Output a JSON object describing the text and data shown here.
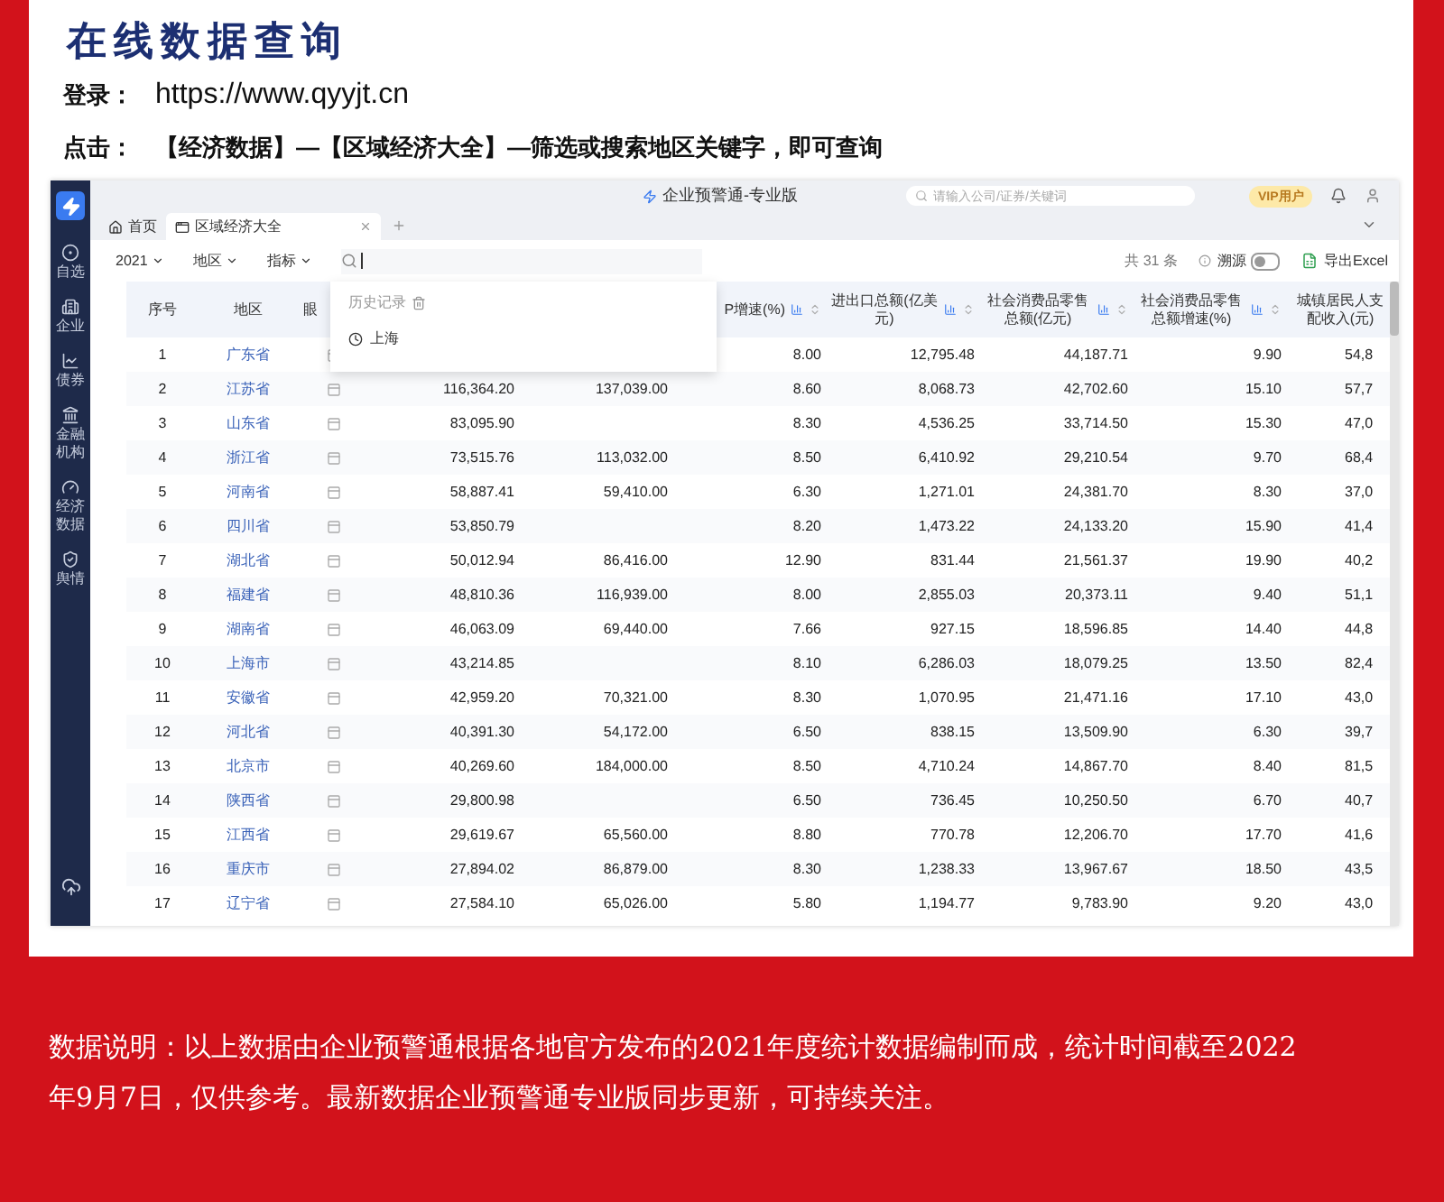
{
  "header": {
    "title": "在线数据查询",
    "login_label": "登录：",
    "login_url": "https://www.qyyjt.cn",
    "click_label": "点击：",
    "click_text": "【经济数据】—【区域经济大全】—筛选或搜索地区关键字，即可查询"
  },
  "app": {
    "sidebar": {
      "items": [
        {
          "label": "自选"
        },
        {
          "label": "企业"
        },
        {
          "label": "债券"
        },
        {
          "label": "金融机构"
        },
        {
          "label": "经济数据"
        },
        {
          "label": "舆情"
        }
      ]
    },
    "title": "企业预警通-专业版",
    "search": {
      "placeholder": "请输入公司/证券/关键词"
    },
    "vip_badge": "VIP用户",
    "tabs": [
      {
        "label": "首页",
        "selected": false
      },
      {
        "label": "区域经济大全",
        "selected": true
      }
    ],
    "filters": [
      {
        "label": "2021"
      },
      {
        "label": "地区"
      },
      {
        "label": "指标"
      }
    ],
    "total": "共 31 条",
    "trace": {
      "label": "溯源",
      "on": false
    },
    "export": "导出Excel",
    "history": {
      "title": "历史记录",
      "items": [
        "上海"
      ]
    },
    "table": {
      "columns": [
        {
          "label": "序号",
          "kind": "text"
        },
        {
          "label": "地区",
          "kind": "text"
        },
        {
          "label": "眼",
          "kind": "text"
        },
        {
          "kind": "blank"
        },
        {
          "kind": "blank"
        },
        {
          "label": "P增速(%)",
          "kind": "metric"
        },
        {
          "label": "进出口总额(亿美元)",
          "kind": "metric"
        },
        {
          "label": "社会消费品零售总额(亿元)",
          "kind": "metric"
        },
        {
          "label": "社会消费品零售总额增速(%)",
          "kind": "metric"
        },
        {
          "label": "城镇居民人支配收入(元)",
          "kind": "text"
        }
      ],
      "rows": [
        {
          "no": "1",
          "region": "广东省",
          "column_6": "8.00",
          "column_7": "12,795.48",
          "column_8": "44,187.71",
          "column_9": "9.90",
          "column_10": "54,8"
        },
        {
          "no": "2",
          "region": "江苏省",
          "column_4": "116,364.20",
          "column_5": "137,039.00",
          "column_6": "8.60",
          "column_7": "8,068.73",
          "column_8": "42,702.60",
          "column_9": "15.10",
          "column_10": "57,7"
        },
        {
          "no": "3",
          "region": "山东省",
          "column_4": "83,095.90",
          "column_6": "8.30",
          "column_7": "4,536.25",
          "column_8": "33,714.50",
          "column_9": "15.30",
          "column_10": "47,0"
        },
        {
          "no": "4",
          "region": "浙江省",
          "column_4": "73,515.76",
          "column_5": "113,032.00",
          "column_6": "8.50",
          "column_7": "6,410.92",
          "column_8": "29,210.54",
          "column_9": "9.70",
          "column_10": "68,4"
        },
        {
          "no": "5",
          "region": "河南省",
          "column_4": "58,887.41",
          "column_5": "59,410.00",
          "column_6": "6.30",
          "column_7": "1,271.01",
          "column_8": "24,381.70",
          "column_9": "8.30",
          "column_10": "37,0"
        },
        {
          "no": "6",
          "region": "四川省",
          "column_4": "53,850.79",
          "column_6": "8.20",
          "column_7": "1,473.22",
          "column_8": "24,133.20",
          "column_9": "15.90",
          "column_10": "41,4"
        },
        {
          "no": "7",
          "region": "湖北省",
          "column_4": "50,012.94",
          "column_5": "86,416.00",
          "column_6": "12.90",
          "column_7": "831.44",
          "column_8": "21,561.37",
          "column_9": "19.90",
          "column_10": "40,2"
        },
        {
          "no": "8",
          "region": "福建省",
          "column_4": "48,810.36",
          "column_5": "116,939.00",
          "column_6": "8.00",
          "column_7": "2,855.03",
          "column_8": "20,373.11",
          "column_9": "9.40",
          "column_10": "51,1"
        },
        {
          "no": "9",
          "region": "湖南省",
          "column_4": "46,063.09",
          "column_5": "69,440.00",
          "column_6": "7.66",
          "column_7": "927.15",
          "column_8": "18,596.85",
          "column_9": "14.40",
          "column_10": "44,8"
        },
        {
          "no": "10",
          "region": "上海市",
          "column_4": "43,214.85",
          "column_6": "8.10",
          "column_7": "6,286.03",
          "column_8": "18,079.25",
          "column_9": "13.50",
          "column_10": "82,4"
        },
        {
          "no": "11",
          "region": "安徽省",
          "column_4": "42,959.20",
          "column_5": "70,321.00",
          "column_6": "8.30",
          "column_7": "1,070.95",
          "column_8": "21,471.16",
          "column_9": "17.10",
          "column_10": "43,0"
        },
        {
          "no": "12",
          "region": "河北省",
          "column_4": "40,391.30",
          "column_5": "54,172.00",
          "column_6": "6.50",
          "column_7": "838.15",
          "column_8": "13,509.90",
          "column_9": "6.30",
          "column_10": "39,7"
        },
        {
          "no": "13",
          "region": "北京市",
          "column_4": "40,269.60",
          "column_5": "184,000.00",
          "column_6": "8.50",
          "column_7": "4,710.24",
          "column_8": "14,867.70",
          "column_9": "8.40",
          "column_10": "81,5"
        },
        {
          "no": "14",
          "region": "陕西省",
          "column_4": "29,800.98",
          "column_6": "6.50",
          "column_7": "736.45",
          "column_8": "10,250.50",
          "column_9": "6.70",
          "column_10": "40,7"
        },
        {
          "no": "15",
          "region": "江西省",
          "column_4": "29,619.67",
          "column_5": "65,560.00",
          "column_6": "8.80",
          "column_7": "770.78",
          "column_8": "12,206.70",
          "column_9": "17.70",
          "column_10": "41,6"
        },
        {
          "no": "16",
          "region": "重庆市",
          "column_4": "27,894.02",
          "column_5": "86,879.00",
          "column_6": "8.30",
          "column_7": "1,238.33",
          "column_8": "13,967.67",
          "column_9": "18.50",
          "column_10": "43,5"
        },
        {
          "no": "17",
          "region": "辽宁省",
          "column_4": "27,584.10",
          "column_5": "65,026.00",
          "column_6": "5.80",
          "column_7": "1,194.77",
          "column_8": "9,783.90",
          "column_9": "9.20",
          "column_10": "43,0"
        }
      ]
    }
  },
  "note": "数据说明：以上数据由企业预警通根据各地官方发布的2021年度统计数据编制而成，统计时间截至2022年9月7日，仅供参考。最新数据企业预警通专业版同步更新，可持续关注。"
}
